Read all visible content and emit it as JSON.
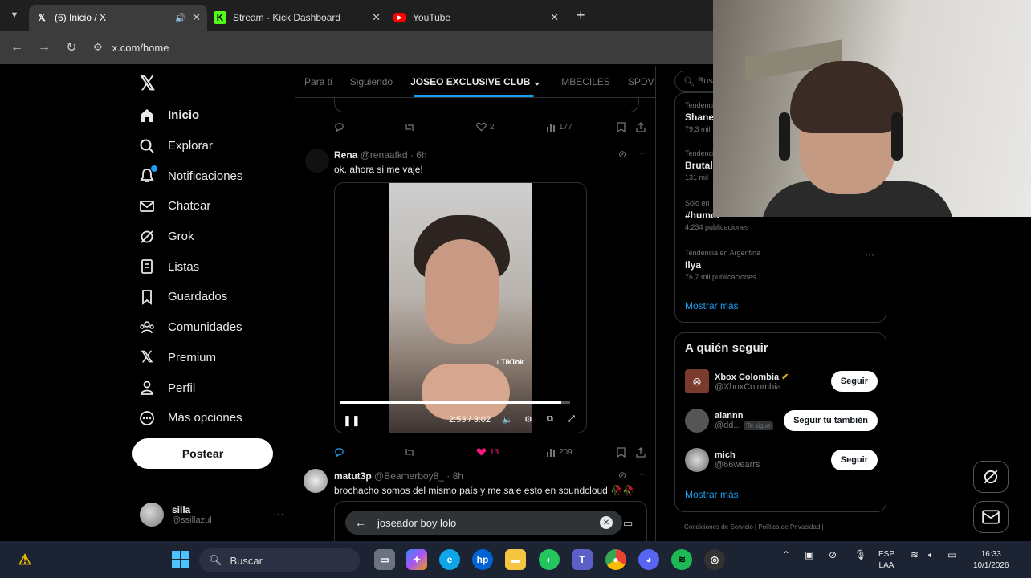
{
  "browser": {
    "tabs": [
      {
        "title": "(6) Inicio / X",
        "favicon": "x-icon",
        "active": true
      },
      {
        "title": "Stream - Kick Dashboard",
        "favicon": "kick-icon",
        "active": false
      },
      {
        "title": "YouTube",
        "favicon": "youtube-icon",
        "active": false
      }
    ],
    "url": "x.com/home"
  },
  "nav": {
    "items": [
      {
        "label": "Inicio",
        "icon": "home-icon"
      },
      {
        "label": "Explorar",
        "icon": "search-icon"
      },
      {
        "label": "Notificaciones",
        "icon": "bell-icon"
      },
      {
        "label": "Chatear",
        "icon": "mail-icon"
      },
      {
        "label": "Grok",
        "icon": "grok-icon"
      },
      {
        "label": "Listas",
        "icon": "list-icon"
      },
      {
        "label": "Guardados",
        "icon": "bookmark-icon"
      },
      {
        "label": "Comunidades",
        "icon": "community-icon"
      },
      {
        "label": "Premium",
        "icon": "x-icon"
      },
      {
        "label": "Perfil",
        "icon": "person-icon"
      },
      {
        "label": "Más opciones",
        "icon": "more-circle-icon"
      }
    ],
    "post_label": "Postear",
    "profile": {
      "name": "silla",
      "handle": "@ssillazul"
    }
  },
  "timeline": {
    "tabs": [
      "Para ti",
      "Siguiendo",
      "JOSEO EXCLUSIVE CLUB",
      "IMBECILES",
      "SPDV"
    ],
    "prev_actions": {
      "likes": "2",
      "views": "177"
    },
    "tweet1": {
      "name": "Rena",
      "handle": "@renaafkd",
      "time": "· 6h",
      "text": "ok. ahora si me vaje!",
      "video": {
        "time": "2:53 / 3:02",
        "watermark": "TikTok",
        "progress": 0.96
      },
      "actions": {
        "likes": "13",
        "views": "209"
      }
    },
    "tweet2": {
      "name": "matut3p",
      "handle": "@Beamerboy8_",
      "time": "· 8h",
      "text": "brochacho somos del mismo país y me sale esto en soundcloud 🥀🥀"
    },
    "search_query": "joseador boy lolo"
  },
  "right": {
    "search_placeholder": "Busc",
    "trends": [
      {
        "context": "Tendencia",
        "title": "Shane",
        "count": "79,3 mil"
      },
      {
        "context": "Tendencia",
        "title": "Brutal",
        "count": "131 mil"
      },
      {
        "context": "Solo en",
        "title": "#humor",
        "count": "4.234 publicaciones"
      },
      {
        "context": "Tendencia en Argentina",
        "title": "Ilya",
        "count": "76,7 mil publicaciones"
      }
    ],
    "show_more": "Mostrar más",
    "who_to_follow_title": "A quién seguir",
    "who": [
      {
        "name": "Xbox Colombia",
        "handle": "@XboxColombia",
        "button": "Seguir"
      },
      {
        "name": "alannn",
        "handle": "@dd...",
        "tag": "Te sigue",
        "button": "Seguir tú también"
      },
      {
        "name": "mich",
        "handle": "@66wearrs",
        "button": "Seguir"
      }
    ],
    "show_more_2": "Mostrar más",
    "footer": "Condiciones de Servicio | Política de Privacidad |"
  },
  "taskbar": {
    "search_label": "Buscar",
    "lang_top": "ESP",
    "lang_bottom": "LAA",
    "time": "16:33",
    "date": "10/1/2026"
  }
}
